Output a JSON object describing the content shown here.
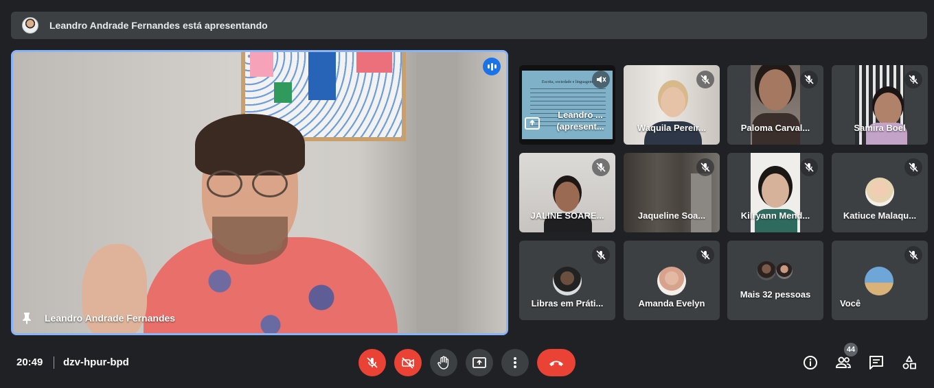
{
  "banner": {
    "text": "Leandro Andrade Fernandes está apresentando"
  },
  "main_video": {
    "name": "Leandro Andrade Fernandes"
  },
  "presentation_tile": {
    "slide_title": "Escrita, sociedade e linguagem",
    "name_line1": "Leandro ...",
    "name_line2": "(apresent..."
  },
  "participants": [
    {
      "name": "Waquila Pereir..."
    },
    {
      "name": "Paloma Carval..."
    },
    {
      "name": "Samira Boel"
    },
    {
      "name": "JALINE SOARE..."
    },
    {
      "name": "Jaqueline Soa..."
    },
    {
      "name": "Kilryann Mend..."
    },
    {
      "name": "Katiuce Malaqu..."
    },
    {
      "name": "Libras em Práti..."
    },
    {
      "name": "Amanda Evelyn"
    },
    {
      "name": "Mais 32 pessoas"
    },
    {
      "name": "Você"
    }
  ],
  "bottom_bar": {
    "time": "20:49",
    "meeting_code": "dzv-hpur-bpd",
    "participant_count": "44"
  },
  "colors": {
    "background": "#202124",
    "accent_blue": "#8ab4f8",
    "danger_red": "#ea4335",
    "tile_gray": "#3c4043"
  }
}
